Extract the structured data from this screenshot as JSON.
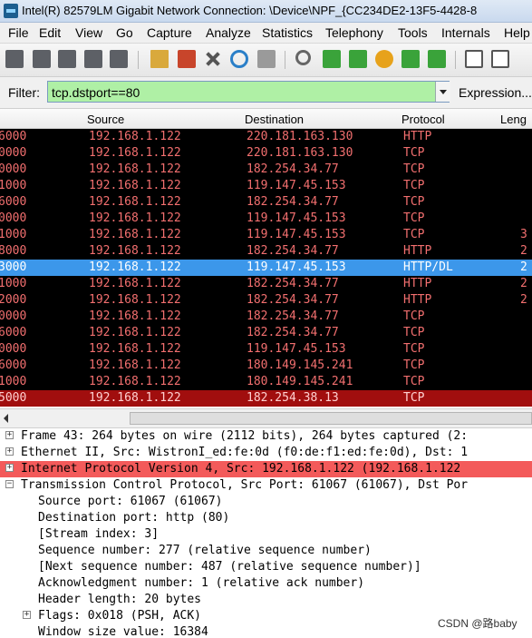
{
  "window": {
    "title": "Intel(R) 82579LM Gigabit Network Connection: \\Device\\NPF_{CC234DE2-13F5-4428-8"
  },
  "menu": [
    "File",
    "Edit",
    "View",
    "Go",
    "Capture",
    "Analyze",
    "Statistics",
    "Telephony",
    "Tools",
    "Internals",
    "Help"
  ],
  "filter": {
    "label": "Filter:",
    "value": "tcp.dstport==80",
    "expression": "Expression..."
  },
  "columns": [
    "Source",
    "Destination",
    "Protocol",
    "Leng"
  ],
  "packets": [
    {
      "no": "6000",
      "source": "192.168.1.122",
      "destination": "220.181.163.130",
      "protocol": "HTTP",
      "length": ""
    },
    {
      "no": "0000",
      "source": "192.168.1.122",
      "destination": "220.181.163.130",
      "protocol": "TCP",
      "length": ""
    },
    {
      "no": "0000",
      "source": "192.168.1.122",
      "destination": "182.254.34.77",
      "protocol": "TCP",
      "length": ""
    },
    {
      "no": "1000",
      "source": "192.168.1.122",
      "destination": "119.147.45.153",
      "protocol": "TCP",
      "length": ""
    },
    {
      "no": "6000",
      "source": "192.168.1.122",
      "destination": "182.254.34.77",
      "protocol": "TCP",
      "length": ""
    },
    {
      "no": "0000",
      "source": "192.168.1.122",
      "destination": "119.147.45.153",
      "protocol": "TCP",
      "length": ""
    },
    {
      "no": "1000",
      "source": "192.168.1.122",
      "destination": "119.147.45.153",
      "protocol": "TCP",
      "length": "3"
    },
    {
      "no": "8000",
      "source": "192.168.1.122",
      "destination": "182.254.34.77",
      "protocol": "HTTP",
      "length": "2"
    },
    {
      "no": "3000",
      "source": "192.168.1.122",
      "destination": "119.147.45.153",
      "protocol": "HTTP/DL",
      "length": "2"
    },
    {
      "no": "1000",
      "source": "192.168.1.122",
      "destination": "182.254.34.77",
      "protocol": "HTTP",
      "length": "2"
    },
    {
      "no": "2000",
      "source": "192.168.1.122",
      "destination": "182.254.34.77",
      "protocol": "HTTP",
      "length": "2"
    },
    {
      "no": "0000",
      "source": "192.168.1.122",
      "destination": "182.254.34.77",
      "protocol": "TCP",
      "length": ""
    },
    {
      "no": "6000",
      "source": "192.168.1.122",
      "destination": "182.254.34.77",
      "protocol": "TCP",
      "length": ""
    },
    {
      "no": "0000",
      "source": "192.168.1.122",
      "destination": "119.147.45.153",
      "protocol": "TCP",
      "length": ""
    },
    {
      "no": "6000",
      "source": "192.168.1.122",
      "destination": "180.149.145.241",
      "protocol": "TCP",
      "length": ""
    },
    {
      "no": "1000",
      "source": "192.168.1.122",
      "destination": "180.149.145.241",
      "protocol": "TCP",
      "length": ""
    },
    {
      "no": "5000",
      "source": "192.168.1.122",
      "destination": "182.254.38.13",
      "protocol": "TCP",
      "length": ""
    }
  ],
  "details": [
    {
      "text": "Frame 43: 264 bytes on wire (2112 bits), 264 bytes captured (2:",
      "expander": "+"
    },
    {
      "text": "Ethernet II, Src: WistronI_ed:fe:0d (f0:de:f1:ed:fe:0d), Dst: 1",
      "expander": "+"
    },
    {
      "text": "Internet Protocol Version 4, Src: 192.168.1.122 (192.168.1.122",
      "expander": "+"
    },
    {
      "text": "Transmission Control Protocol, Src Port: 61067 (61067), Dst Por",
      "expander": "−"
    },
    {
      "text": "Source port: 61067 (61067)",
      "expander": ""
    },
    {
      "text": "Destination port: http (80)",
      "expander": ""
    },
    {
      "text": "[Stream index: 3]",
      "expander": ""
    },
    {
      "text": "Sequence number: 277    (relative sequence number)",
      "expander": ""
    },
    {
      "text": "[Next sequence number: 487    (relative sequence number)]",
      "expander": ""
    },
    {
      "text": "Acknowledgment number: 1    (relative ack number)",
      "expander": ""
    },
    {
      "text": "Header length: 20 bytes",
      "expander": ""
    },
    {
      "text": "Flags: 0x018 (PSH, ACK)",
      "expander": "+"
    },
    {
      "text": "Window size value: 16384",
      "expander": ""
    }
  ],
  "watermark": "CSDN @路baby",
  "colors": {
    "row_bg": "#000000",
    "row_text": "#f26f6f",
    "selected_bg": "#3c97ea",
    "selected_text": "#ffffff",
    "last_row_bg": "#a10e0e",
    "last_row_text": "#ffd0d0",
    "filter_bg": "#aff0a5",
    "detail_highlight": "#f35a5a"
  }
}
